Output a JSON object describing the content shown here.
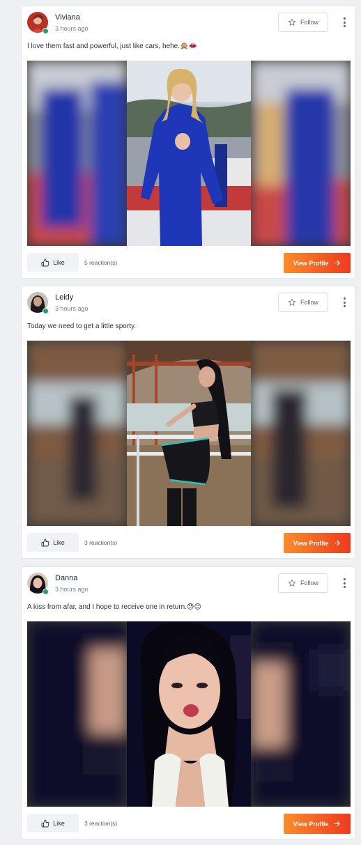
{
  "posts": [
    {
      "username": "Viviana",
      "timestamp": "3 hours ago",
      "caption": "I love them fast and powerful, just like cars, hehe.🙊👄",
      "follow_label": "Follow",
      "like_label": "Like",
      "reactions": "5 reaction(s)",
      "view_profile_label": "View Profile",
      "image_alt": "Woman in blue racing suit"
    },
    {
      "username": "Leidy",
      "timestamp": "3 hours ago",
      "caption": "Today we need to get a little sporty.",
      "follow_label": "Follow",
      "like_label": "Like",
      "reactions": "3 reaction(s)",
      "view_profile_label": "View Profile",
      "image_alt": "Woman in sporty outfit at arena"
    },
    {
      "username": "Danna",
      "timestamp": "3 hours ago",
      "caption": "A kiss from afar, and I hope to receive one in return.😓😊",
      "follow_label": "Follow",
      "like_label": "Like",
      "reactions": "3 reaction(s)",
      "view_profile_label": "View Profile",
      "image_alt": "Woman blowing a kiss"
    }
  ],
  "colors": {
    "accent_start": "#fb8c2a",
    "accent_end": "#ee3a1e",
    "online": "#22a06b"
  },
  "icons": {
    "follow": "star-icon",
    "like": "thumbs-up-icon",
    "view_profile": "arrow-right-icon",
    "more": "more-vertical-icon"
  }
}
